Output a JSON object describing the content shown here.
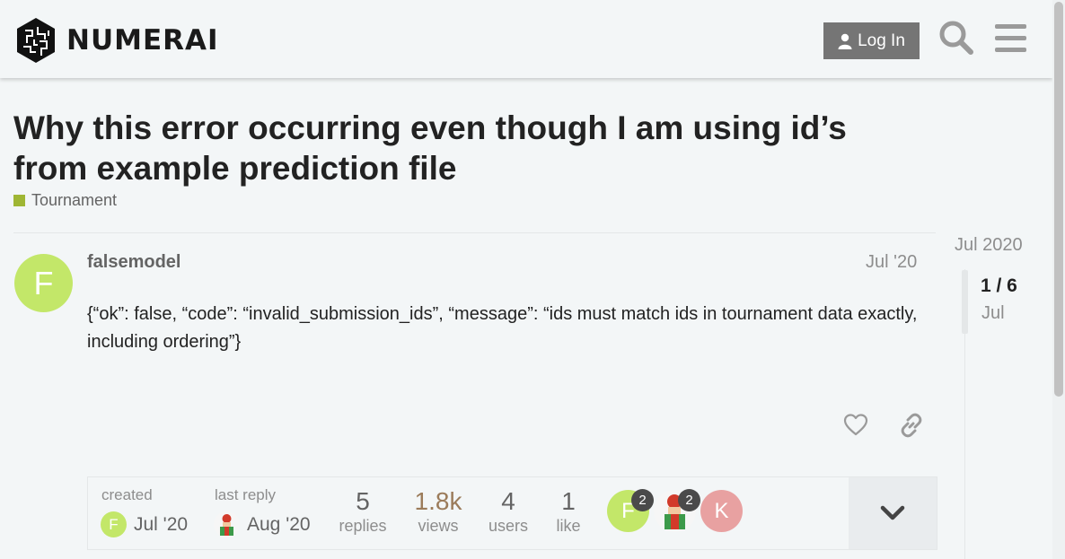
{
  "header": {
    "logo_text": "NUMERAI",
    "login_label": "Log In",
    "icons": [
      "numerai-logo-icon",
      "user-icon",
      "search-icon",
      "menu-icon"
    ]
  },
  "topic": {
    "title": "Why this error occurring even though I am using id’s from example prediction file",
    "category": "Tournament",
    "category_color": "#9fb634"
  },
  "post": {
    "avatar_letter": "F",
    "avatar_color": "#c3e769",
    "username": "falsemodel",
    "date": "Jul '20",
    "body": "{“ok”: false, “code”: “invalid_submission_ids”, “message”: “ids must match ids in tournament data exactly, including ordering”}"
  },
  "summary": {
    "created_label": "created",
    "created_date": "Jul '20",
    "last_reply_label": "last reply",
    "last_reply_date": "Aug '20",
    "stats": [
      {
        "value": "5",
        "label": "replies"
      },
      {
        "value": "1.8k",
        "label": "views",
        "highlight": "#9b7b5a"
      },
      {
        "value": "4",
        "label": "users"
      },
      {
        "value": "1",
        "label": "like"
      }
    ],
    "participants": [
      {
        "letter": "F",
        "color": "#c3e769",
        "count": "2"
      },
      {
        "letter": "",
        "color": "#ffffff",
        "count": "2"
      },
      {
        "letter": "K",
        "color": "#e8a1a1"
      }
    ]
  },
  "timeline": {
    "start": "Jul 2020",
    "position": "1 / 6",
    "date": "Jul"
  }
}
